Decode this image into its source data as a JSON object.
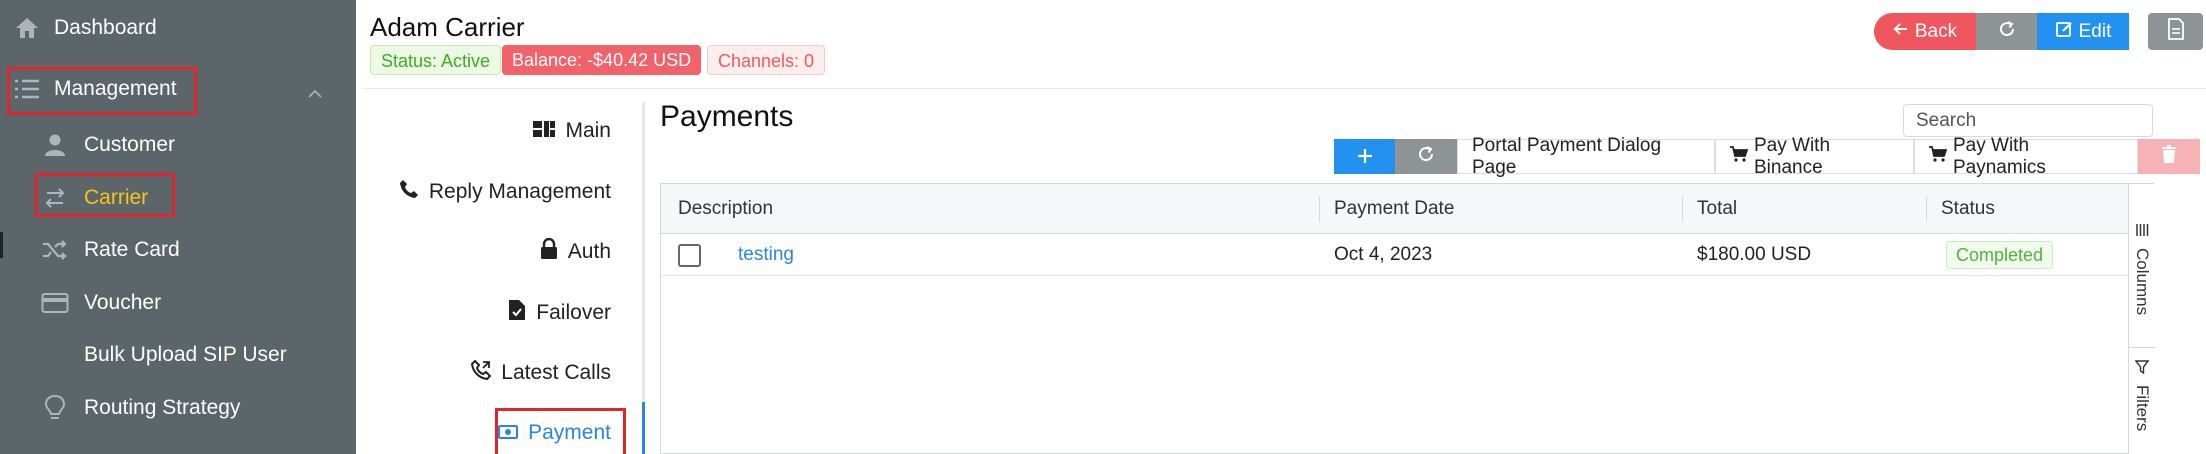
{
  "sidebar": {
    "dashboard": "Dashboard",
    "management": "Management",
    "customer": "Customer",
    "carrier": "Carrier",
    "rate_card": "Rate Card",
    "voucher": "Voucher",
    "bulk_upload": "Bulk Upload SIP User",
    "routing_strategy": "Routing Strategy"
  },
  "header": {
    "title": "Adam Carrier",
    "status": "Status: Active",
    "balance": "Balance: -$40.42 USD",
    "channels": "Channels: 0",
    "back_label": "Back",
    "edit_label": "Edit"
  },
  "subnav": {
    "items": [
      "Main",
      "Reply Management",
      "Auth",
      "Failover",
      "Latest Calls",
      "Payment"
    ],
    "active": "Payment"
  },
  "payments": {
    "title": "Payments",
    "search_placeholder": "Search",
    "toolbar": {
      "portal": "Portal Payment Dialog Page",
      "binance": "Pay With Binance",
      "paynamics": "Pay With Paynamics"
    },
    "columns": [
      "Description",
      "Payment Date",
      "Total",
      "Status"
    ],
    "rows": [
      {
        "description": "testing",
        "date": "Oct 4, 2023",
        "total": "$180.00 USD",
        "status": "Completed"
      }
    ],
    "side_tabs": [
      "Columns",
      "Filters"
    ]
  },
  "colors": {
    "accent": "#2291f0",
    "danger": "#f0565e",
    "sidebar": "#5c656a",
    "active_nav": "#f5c518",
    "success": "#3cae20"
  },
  "icons": [
    "home-icon",
    "list-icon",
    "chevron-up-icon",
    "user-icon",
    "swap-icon",
    "shuffle-icon",
    "card-icon",
    "bulb-icon",
    "grid-icon",
    "phone-icon",
    "lock-icon",
    "file-icon",
    "phone-log-icon",
    "money-icon",
    "arrow-left-icon",
    "refresh-icon",
    "edit-icon",
    "document-icon",
    "plus-icon",
    "cart-icon",
    "trash-icon",
    "columns-icon",
    "filter-icon"
  ]
}
